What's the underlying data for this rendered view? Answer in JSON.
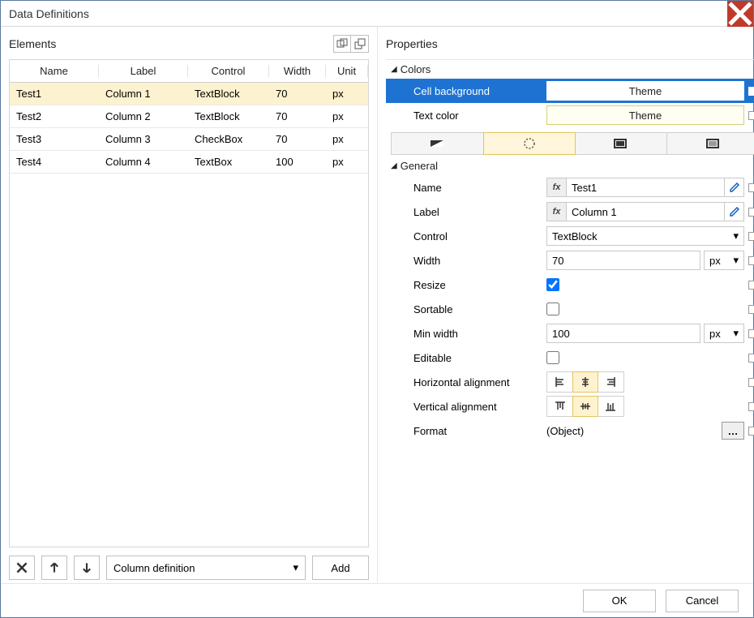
{
  "window": {
    "title": "Data Definitions"
  },
  "elements": {
    "title": "Elements",
    "columns": {
      "name": "Name",
      "label": "Label",
      "control": "Control",
      "width": "Width",
      "unit": "Unit"
    },
    "rows": [
      {
        "name": "Test1",
        "label": "Column 1",
        "control": "TextBlock",
        "width": "70",
        "unit": "px",
        "selected": true
      },
      {
        "name": "Test2",
        "label": "Column 2",
        "control": "TextBlock",
        "width": "70",
        "unit": "px",
        "selected": false
      },
      {
        "name": "Test3",
        "label": "Column 3",
        "control": "CheckBox",
        "width": "70",
        "unit": "px",
        "selected": false
      },
      {
        "name": "Test4",
        "label": "Column 4",
        "control": "TextBox",
        "width": "100",
        "unit": "px",
        "selected": false
      }
    ],
    "dropdown": "Column definition",
    "add_label": "Add"
  },
  "properties": {
    "title": "Properties",
    "groups": {
      "colors": {
        "label": "Colors",
        "cell_bg_label": "Cell background",
        "cell_bg_value": "Theme",
        "text_color_label": "Text color",
        "text_color_value": "Theme"
      },
      "general": {
        "label": "General",
        "name_label": "Name",
        "name_value": "Test1",
        "label_label": "Label",
        "label_value": "Column 1",
        "control_label": "Control",
        "control_value": "TextBlock",
        "width_label": "Width",
        "width_value": "70",
        "width_unit": "px",
        "resize_label": "Resize",
        "resize_checked": true,
        "sortable_label": "Sortable",
        "sortable_checked": false,
        "minwidth_label": "Min width",
        "minwidth_value": "100",
        "minwidth_unit": "px",
        "editable_label": "Editable",
        "editable_checked": false,
        "halign_label": "Horizontal alignment",
        "halign": "center",
        "valign_label": "Vertical alignment",
        "valign": "middle",
        "format_label": "Format",
        "format_value": "(Object)"
      }
    }
  },
  "footer": {
    "ok": "OK",
    "cancel": "Cancel"
  }
}
